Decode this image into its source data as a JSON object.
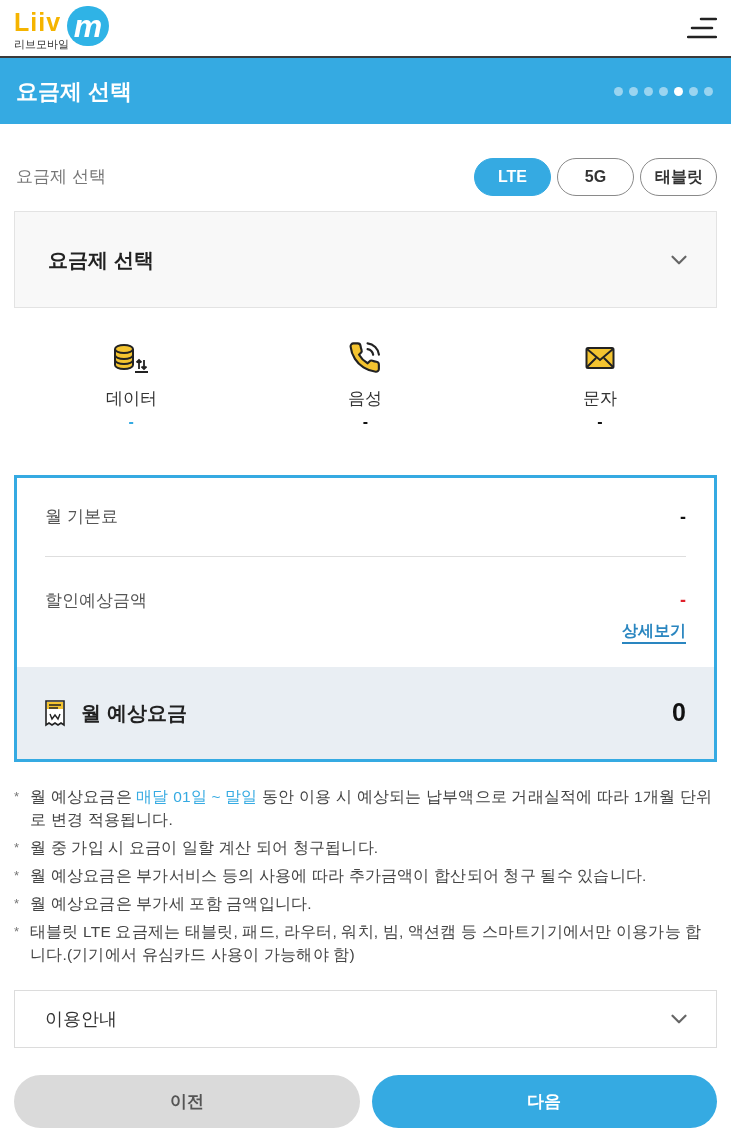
{
  "header": {
    "logo": {
      "wordmark": "Liiv",
      "bubble_letter": "m",
      "caption": "리브모바일"
    }
  },
  "title_bar": {
    "title": "요금제 선택",
    "steps": [
      {
        "selected": false
      },
      {
        "selected": false
      },
      {
        "selected": false
      },
      {
        "selected": false
      },
      {
        "selected": true
      },
      {
        "selected": false
      },
      {
        "selected": false
      }
    ]
  },
  "plan_type": {
    "label": "요금제 선택",
    "tabs": [
      {
        "label": "LTE",
        "selected": true
      },
      {
        "label": "5G",
        "selected": false
      },
      {
        "label": "태블릿",
        "selected": false
      }
    ]
  },
  "plan_dropdown": {
    "value": "요금제 선택",
    "expanded": false
  },
  "features": [
    {
      "kind": "data",
      "label": "데이터",
      "value": "-",
      "color": "#35aae2"
    },
    {
      "kind": "voice",
      "label": "음성",
      "value": "-",
      "color": "#111111"
    },
    {
      "kind": "sms",
      "label": "문자",
      "value": "-",
      "color": "#111111"
    }
  ],
  "summary": {
    "rows": [
      {
        "kind": "base",
        "label": "월 기본료",
        "value": "-"
      },
      {
        "kind": "discount",
        "label": "할인예상금액",
        "value": "-",
        "link": "상세보기"
      }
    ],
    "total": {
      "label": "월 예상요금",
      "value": "0"
    }
  },
  "notes": [
    {
      "marker": "*",
      "parts": [
        {
          "text": "월 예상요금은 ",
          "highlight": false
        },
        {
          "text": "매달 01일 ~ 말일",
          "highlight": true
        },
        {
          "text": " 동안 이용 시 예상되는 납부액으로 거래실적에 따라 1개월 단위로 변경 적용됩니다.",
          "highlight": false
        }
      ]
    },
    {
      "marker": "*",
      "text": "월 중 가입 시 요금이 일할 계산 되어 청구됩니다."
    },
    {
      "marker": "*",
      "text": "월 예상요금은 부가서비스 등의 사용에 따라 추가금액이 합산되어 청구 될수 있습니다."
    },
    {
      "marker": "*",
      "text": "월 예상요금은 부가세 포함 금액입니다."
    },
    {
      "marker": "*",
      "text": "태블릿 LTE 요금제는 태블릿, 패드, 라우터, 워치, 빔, 액션캠 등 스마트기기에서만 이용가능 합니다.(기기에서 유심카드 사용이 가능해야 함)"
    }
  ],
  "guide": {
    "label": "이용안내",
    "expanded": false
  },
  "buttons": [
    {
      "kind": "secondary",
      "label": "이전"
    },
    {
      "kind": "primary",
      "label": "다음"
    }
  ]
}
